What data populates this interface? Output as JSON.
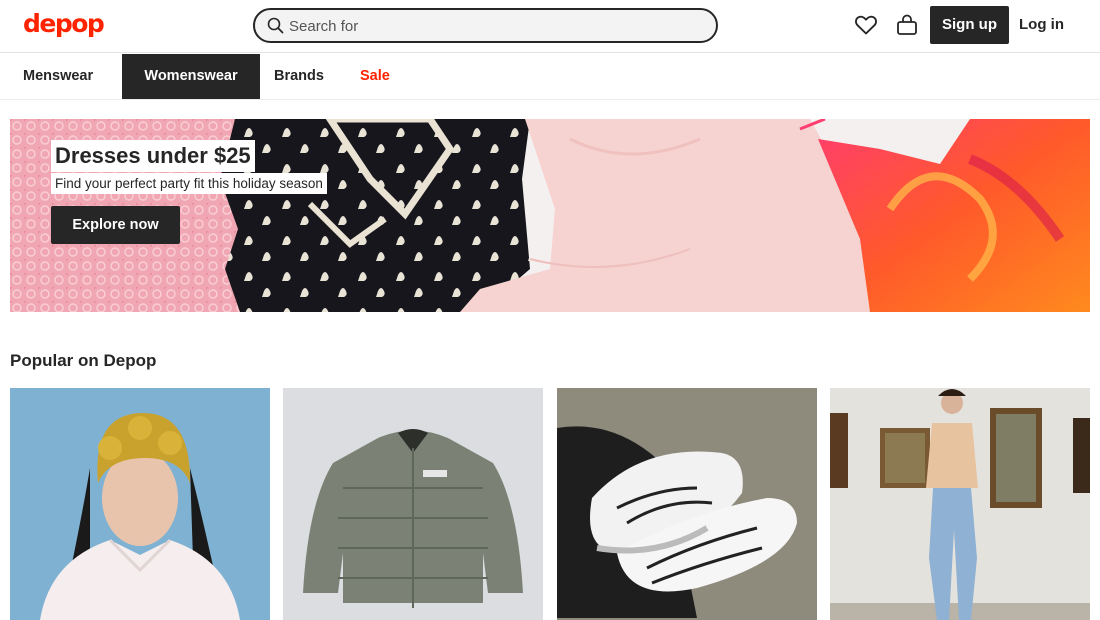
{
  "header": {
    "logo": "depop",
    "search": {
      "placeholder": "Search for",
      "value": ""
    },
    "icons": [
      "search-icon",
      "heart-icon",
      "bag-icon"
    ],
    "signup_label": "Sign up",
    "login_label": "Log in"
  },
  "nav": {
    "items": [
      {
        "label": "Menswear",
        "active": false
      },
      {
        "label": "Womenswear",
        "active": true
      },
      {
        "label": "Brands",
        "active": false
      },
      {
        "label": "Sale",
        "active": false,
        "color": "#ff2300"
      }
    ]
  },
  "banner": {
    "title": "Dresses under $25",
    "subtitle": "Find your perfect party fit this holiday season",
    "cta_label": "Explore now"
  },
  "popular": {
    "title": "Popular on Depop",
    "items": [
      {
        "icon": "product-photo"
      },
      {
        "icon": "product-photo"
      },
      {
        "icon": "product-photo"
      },
      {
        "icon": "product-photo"
      }
    ]
  },
  "colors": {
    "brand": "#ff2300",
    "dark": "#262626",
    "sale": "#ff2300"
  }
}
